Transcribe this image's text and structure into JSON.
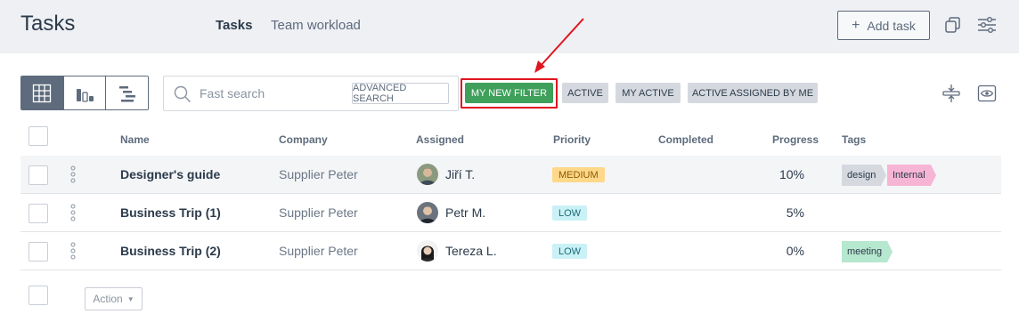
{
  "header": {
    "title": "Tasks",
    "tabs": [
      {
        "label": "Tasks",
        "active": true
      },
      {
        "label": "Team workload",
        "active": false
      }
    ],
    "add_task_label": "Add task",
    "add_task_icon": "plus-icon"
  },
  "toolbar": {
    "views": [
      "grid-view-icon",
      "chart-view-icon",
      "gantt-view-icon"
    ],
    "search": {
      "placeholder": "Fast search",
      "value": "",
      "advanced_label": "ADVANCED SEARCH"
    },
    "filters": [
      {
        "label": "MY NEW FILTER",
        "color": "#3ea05a",
        "highlighted": true
      },
      {
        "label": "ACTIVE"
      },
      {
        "label": "MY ACTIVE"
      },
      {
        "label": "ACTIVE ASSIGNED BY ME"
      }
    ]
  },
  "table": {
    "columns": [
      "Name",
      "Company",
      "Assigned",
      "Priority",
      "Completed",
      "Progress",
      "Tags"
    ],
    "rows": [
      {
        "name": "Designer's guide",
        "company": "Supplier Peter",
        "assigned": "Jiří T.",
        "priority": "MEDIUM",
        "priority_bg": "#ffd88a",
        "priority_fg": "#8a5a00",
        "completed": "",
        "progress": "10%",
        "tags": [
          {
            "label": "design",
            "color": "#d5d9df"
          },
          {
            "label": "Internal",
            "color": "#f7b5d6"
          }
        ]
      },
      {
        "name": "Business Trip (1)",
        "company": "Supplier Peter",
        "assigned": "Petr M.",
        "priority": "LOW",
        "priority_bg": "#c9f1f6",
        "priority_fg": "#1d6c78",
        "completed": "",
        "progress": "5%",
        "tags": []
      },
      {
        "name": "Business Trip (2)",
        "company": "Supplier Peter",
        "assigned": "Tereza L.",
        "priority": "LOW",
        "priority_bg": "#c9f1f6",
        "priority_fg": "#1d6c78",
        "completed": "",
        "progress": "0%",
        "tags": [
          {
            "label": "meeting",
            "color": "#b6e7cf"
          }
        ]
      }
    ]
  },
  "footer": {
    "action_label": "Action"
  }
}
